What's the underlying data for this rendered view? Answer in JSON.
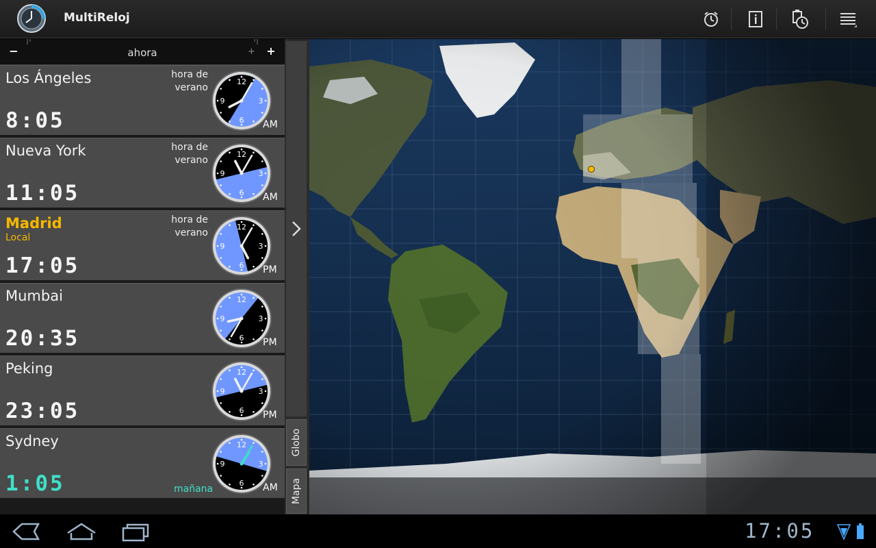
{
  "app": {
    "title": "MultiReloj"
  },
  "actionbar": {
    "icons": [
      "alarm-icon",
      "info-icon",
      "clock-settings-icon",
      "menu-icon"
    ]
  },
  "timeline": {
    "minus": "−",
    "plus": "+",
    "plus_small": "+",
    "label": "ahora"
  },
  "cities": [
    {
      "name": "Los Ángeles",
      "sub": "",
      "time": "8:05",
      "dst": [
        "hora de",
        "verano"
      ],
      "ampm": "AM",
      "extra": "",
      "hour": 8,
      "minute": 5,
      "local": false
    },
    {
      "name": "Nueva York",
      "sub": "",
      "time": "11:05",
      "dst": [
        "hora de",
        "verano"
      ],
      "ampm": "AM",
      "extra": "",
      "hour": 11,
      "minute": 5,
      "local": false
    },
    {
      "name": "Madrid",
      "sub": "Local",
      "time": "17:05",
      "dst": [
        "hora de",
        "verano"
      ],
      "ampm": "PM",
      "extra": "",
      "hour": 17,
      "minute": 5,
      "local": true
    },
    {
      "name": "Mumbai",
      "sub": "",
      "time": "20:35",
      "dst": [
        "",
        ""
      ],
      "ampm": "PM",
      "extra": "",
      "hour": 20,
      "minute": 35,
      "local": false
    },
    {
      "name": "Peking",
      "sub": "",
      "time": "23:05",
      "dst": [
        "",
        ""
      ],
      "ampm": "PM",
      "extra": "",
      "hour": 23,
      "minute": 5,
      "local": false
    },
    {
      "name": "Sydney",
      "sub": "",
      "time": "1:05",
      "dst": [
        "",
        ""
      ],
      "ampm": "AM",
      "extra": "mañana",
      "hour": 1,
      "minute": 5,
      "local": false
    }
  ],
  "clock_numerals": [
    "12",
    "3",
    "6",
    "9"
  ],
  "side_tabs": {
    "globe": "Globo",
    "map": "Mapa"
  },
  "status": {
    "time": "17:05"
  },
  "colors": {
    "accent": "#f5b800",
    "cyan": "#3ee0c8",
    "clock_day": "#6f97ff",
    "clock_night": "#000000"
  }
}
